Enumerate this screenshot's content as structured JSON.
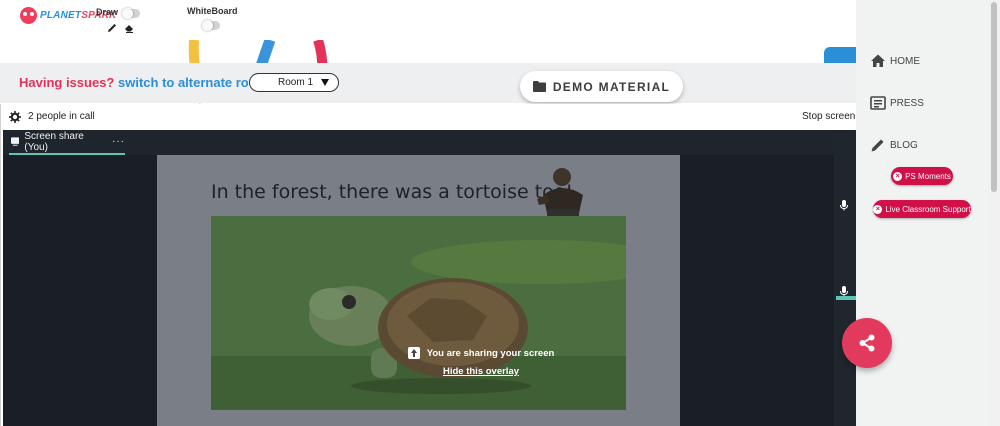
{
  "topbar": {
    "logo": {
      "part1": "PLANET",
      "part2": "SPARK"
    },
    "draw_label": "Draw",
    "whiteboard_label": "WhiteBoard",
    "icons": [
      "pencil-icon",
      "eraser-icon",
      "close-icon"
    ]
  },
  "notice": {
    "question": "Having issues?",
    "switch_link": "switch to alternate room",
    "room_value": "Room 1",
    "demo_label": "DEMO MATERIAL"
  },
  "call": {
    "people_count": "2 people in call",
    "stop_share": "Stop screen",
    "tab_label": "Screen share (You)",
    "tab_more": "···",
    "slide_title": "In the forest, there was a tortoise too!",
    "overlay_message": "You are sharing your screen",
    "overlay_link": "Hide this overlay"
  },
  "sidebar": {
    "items": [
      {
        "label": "HOME",
        "icon": "home-icon"
      },
      {
        "label": "PRESS",
        "icon": "newspaper-icon"
      },
      {
        "label": "BLOG",
        "icon": "pencil-icon"
      }
    ],
    "pills": [
      {
        "label": "PS Moments"
      },
      {
        "label": "Live Classroom Support"
      }
    ]
  },
  "colors": {
    "brand_red": "#e3325a",
    "brand_blue": "#2a8fd7",
    "pill_red": "#d1104a",
    "accent_teal": "#5cc6b6"
  }
}
